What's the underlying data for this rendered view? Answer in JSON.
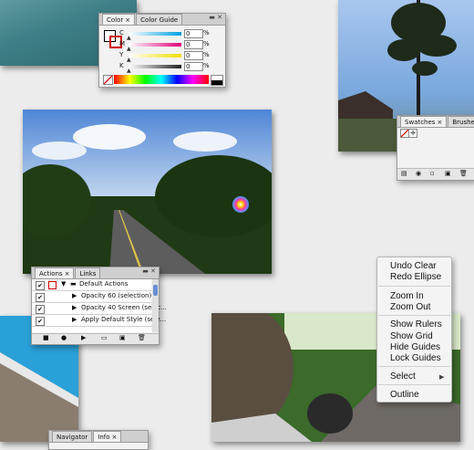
{
  "color_panel": {
    "tabs": [
      "Color",
      "Color Guide"
    ],
    "close_glyph": "×",
    "channels": [
      {
        "label": "C",
        "value": "0",
        "unit": "%",
        "color": "#00a0e0"
      },
      {
        "label": "M",
        "value": "0",
        "unit": "%",
        "color": "#e0007a"
      },
      {
        "label": "Y",
        "value": "0",
        "unit": "%",
        "color": "#f0e000"
      },
      {
        "label": "K",
        "value": "0",
        "unit": "%",
        "color": "#222222"
      }
    ]
  },
  "swatches_panel": {
    "tabs": [
      "Swatches",
      "Brushes"
    ],
    "close_glyph": "×"
  },
  "actions_panel": {
    "tabs": [
      "Actions",
      "Links"
    ],
    "close_glyph": "×",
    "rows": [
      {
        "label": "Default Actions",
        "checked": true
      },
      {
        "label": "Opacity 60 (selection)",
        "checked": true
      },
      {
        "label": "Opacity 40 Screen (selec...",
        "checked": true
      },
      {
        "label": "Apply Default Style (sele...",
        "checked": true
      }
    ]
  },
  "bottom_panel": {
    "tabs": [
      "Navigator",
      "Info"
    ],
    "close_glyph": "×"
  },
  "context_menu": {
    "items": [
      "Undo Clear",
      "Redo Ellipse",
      "Zoom In",
      "Zoom Out",
      "Show Rulers",
      "Show Grid",
      "Hide Guides",
      "Lock Guides",
      "Select",
      "Outline"
    ],
    "submenu_arrow": "▶"
  },
  "icons": [
    "busy-spinner-icon",
    "panel-menu-icon",
    "new-swatch-icon",
    "delete-icon",
    "checkmark-icon",
    "folder-icon",
    "play-icon",
    "record-icon",
    "stop-icon"
  ]
}
